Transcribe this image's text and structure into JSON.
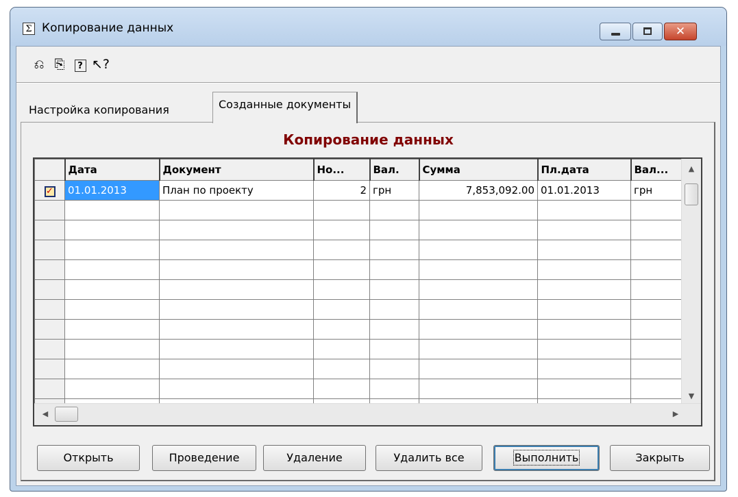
{
  "window": {
    "title": "Копирование данных"
  },
  "toolbar": [
    {
      "icon": "copy-back-icon",
      "glyph": "⎌"
    },
    {
      "icon": "copy-forward-icon",
      "glyph": "⎘"
    },
    {
      "icon": "help-icon",
      "glyph": "?"
    },
    {
      "icon": "context-help-icon",
      "glyph": "↖?"
    }
  ],
  "tabs": [
    "Настройка копирования",
    "Созданные документы"
  ],
  "heading": "Копирование данных",
  "grid": {
    "columns": [
      "Дата",
      "Документ",
      "Но...",
      "Вал.",
      "Сумма",
      "Пл.дата",
      "Вал..."
    ],
    "rows": [
      [
        "01.01.2013",
        "План по проекту",
        "2",
        "грн",
        "7,853,092.00",
        "01.01.2013",
        "грн"
      ]
    ]
  },
  "buttons": {
    "open": "Открыть",
    "post": "Проведение",
    "delete": "Удаление",
    "delete_all": "Удалить все",
    "run": "Выполнить",
    "close": "Закрыть"
  }
}
